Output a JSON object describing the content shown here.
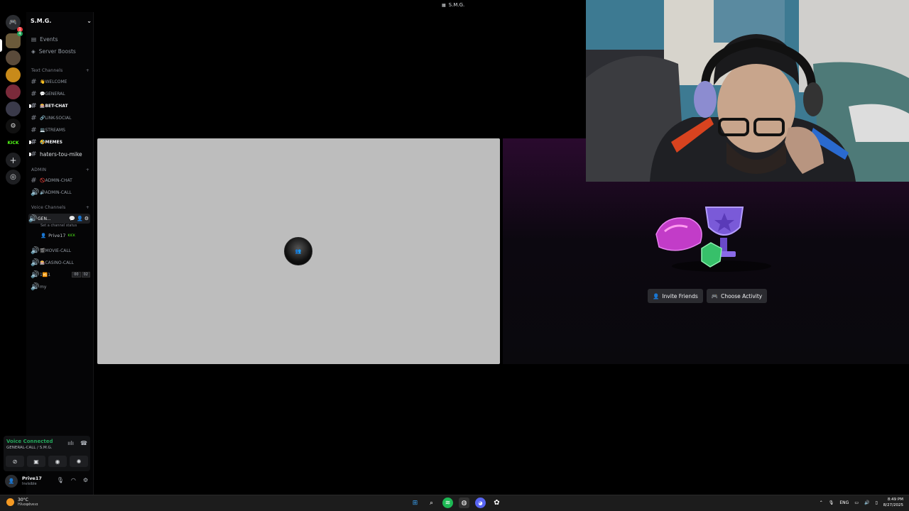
{
  "window": {
    "title": "S.M.G."
  },
  "servers": [
    {
      "label": "🎮",
      "badge": "1"
    },
    {
      "label": "",
      "badge": "4"
    },
    {
      "label": ""
    },
    {
      "label": ""
    },
    {
      "label": ""
    },
    {
      "label": ""
    },
    {
      "label": "KICK"
    }
  ],
  "sidebar": {
    "server_name": "S.M.G.",
    "events_label": "Events",
    "boosts_label": "Server Boosts",
    "text_category": "Text Channels",
    "admin_category": "ADMIN",
    "voice_category": "Voice Channels",
    "text_channels": [
      "👋WELCOME",
      "💬GENERAL",
      "🎰BET-CHAT",
      "🔗LINK-SOCIAL",
      "💻STREAMS",
      "🤣MEMES",
      "haters-tou-mike"
    ],
    "admin_channels": [
      "🚫ADMIN-CHAT",
      "🔊ADMIN-CALL"
    ],
    "voice_channels": {
      "active": "GEN...",
      "status_placeholder": "Set a channel status",
      "user": "Prive17",
      "user_tag": "KICK",
      "others": [
        "🎬MOVIE-CALL",
        "🎰CASINO-CALL",
        "1🆚1",
        "my"
      ],
      "limit_a": "00",
      "limit_b": "02"
    }
  },
  "voice_panel": {
    "title": "Voice Connected",
    "subtitle": "GENERAL-CALL / S.M.G."
  },
  "user_panel": {
    "name": "Prive17",
    "status": "Invisible"
  },
  "main": {
    "activity": {
      "invite_label": "Invite Friends",
      "choose_label": "Choose Activity"
    }
  },
  "taskbar": {
    "temp": "30°C",
    "weather": "Ηλιοφάνεια",
    "lang": "ENG",
    "time": "8:49 PM",
    "date": "8/27/2025"
  },
  "colors": {
    "connected": "#23a55a",
    "kick": "#53fc18",
    "badge": "#f23f43"
  }
}
